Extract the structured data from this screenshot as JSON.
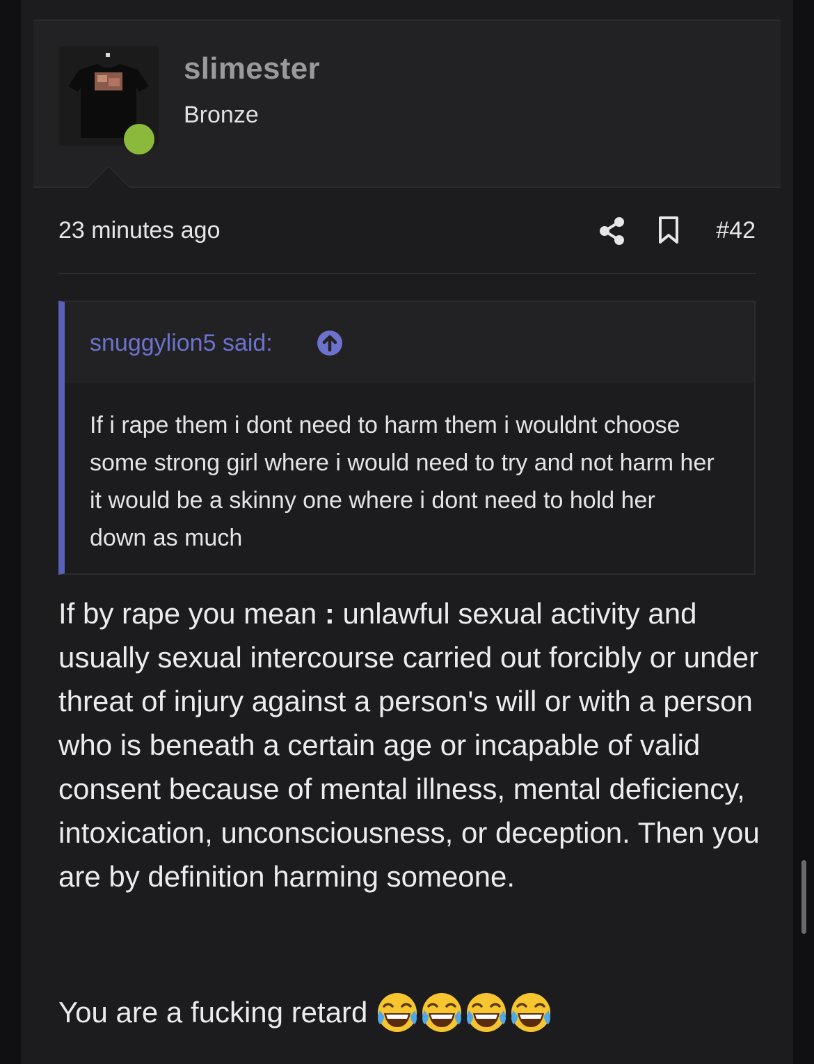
{
  "user": {
    "name": "slimester",
    "title": "Bronze",
    "online_color": "#8ab93b"
  },
  "post": {
    "timestamp": "23 minutes ago",
    "number": "#42",
    "icons": [
      "share-icon",
      "bookmark-icon"
    ]
  },
  "quote": {
    "author": "snuggylion5 said:",
    "icon": "arrow-up-circle-icon",
    "text": "If i rape them i dont need to harm them i wouldnt choose some strong girl where i would need to try and not harm her it would be a skinny one where i dont need to hold her down as much",
    "accent_color": "#5a5fb8"
  },
  "body": {
    "paragraph_pre": "If by rape you mean ",
    "colon": ":",
    "paragraph_post": " unlawful sexual activity and usually sexual intercourse carried out forcibly or under threat of injury against a person's will or with a person who is beneath a certain age or incapable of valid consent because of mental illness, mental deficiency, intoxication, unconsciousness, or deception. Then you are by definition harming someone.",
    "reply": "You are a fucking retard",
    "emojis": [
      "tears-of-joy-emoji",
      "tears-of-joy-emoji",
      "tears-of-joy-emoji",
      "tears-of-joy-emoji"
    ]
  }
}
